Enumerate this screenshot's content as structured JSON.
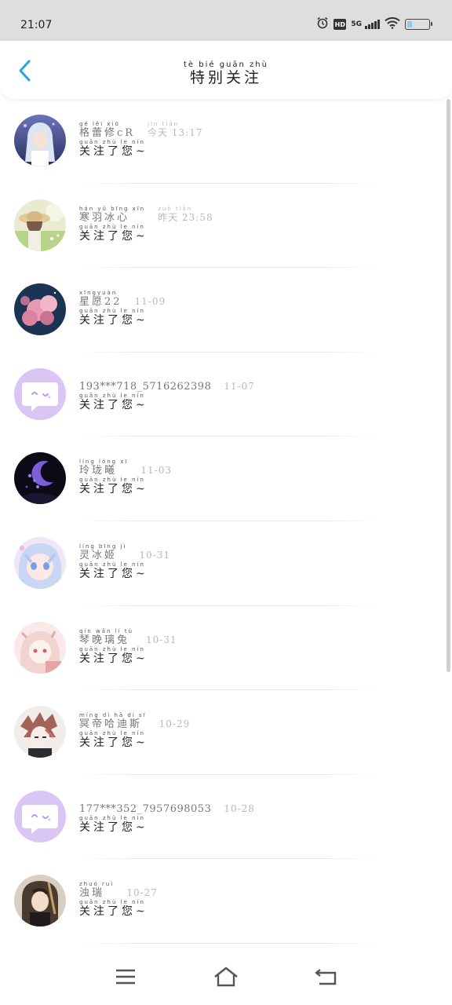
{
  "status_bar": {
    "time": "21:07",
    "hd_label": "HD",
    "network_label": "5G",
    "battery_level": 0.22,
    "icons": [
      "alarm-icon",
      "hd-icon",
      "signal-icon",
      "wifi-icon",
      "battery-icon"
    ]
  },
  "header": {
    "title_pinyin": "tè bié guān zhù",
    "title": "特别关注",
    "back_icon": "chevron-left-icon",
    "accent_color": "#2aa3e0"
  },
  "list": [
    {
      "name_pinyin": "gé lěi xiū",
      "name": "格蕾修cR",
      "date_pinyin": "jīn tiān",
      "date": "今天 13:17",
      "msg_pinyin": "guān zhù le nín",
      "message": "关注了您~",
      "avatar": "anime-girl-white-hair"
    },
    {
      "name_pinyin": "hán yǔ bīng xīn",
      "name": "寒羽冰心",
      "date_pinyin": "zuó tiān",
      "date": "昨天 23:58",
      "msg_pinyin": "guān zhù le nín",
      "message": "关注了您~",
      "avatar": "girl-straw-hat-field"
    },
    {
      "name_pinyin": "xīngyuàn",
      "name": "星愿22",
      "date_pinyin": "",
      "date": "11-09",
      "msg_pinyin": "guān zhù le nín",
      "message": "关注了您~",
      "avatar": "pink-blossom-night"
    },
    {
      "name_pinyin": "",
      "name": "193***718_5716262398",
      "date_pinyin": "",
      "date": "11-07",
      "msg_pinyin": "guān zhù le nín",
      "message": "关注了您~",
      "avatar": "default-chat-bubble"
    },
    {
      "name_pinyin": "líng lóng xī",
      "name": "玲珑曦",
      "date_pinyin": "",
      "date": "11-03",
      "msg_pinyin": "guān zhù le nín",
      "message": "关注了您~",
      "avatar": "dark-moon"
    },
    {
      "name_pinyin": "líng bīng jì",
      "name": "灵冰姬",
      "date_pinyin": "",
      "date": "10-31",
      "msg_pinyin": "guān zhù le nín",
      "message": "关注了您~",
      "avatar": "anime-girl-pastel"
    },
    {
      "name_pinyin": "qín wǎn lí tù",
      "name": "琴晚璃兔",
      "date_pinyin": "",
      "date": "10-31",
      "msg_pinyin": "guān zhù le nín",
      "message": "关注了您~",
      "avatar": "anime-girl-pink"
    },
    {
      "name_pinyin": "míng dì hā dí sī",
      "name": "冥帝哈迪斯",
      "date_pinyin": "",
      "date": "10-29",
      "msg_pinyin": "guān zhù le nín",
      "message": "关注了您~",
      "avatar": "anime-boy-sketch"
    },
    {
      "name_pinyin": "",
      "name": "177***352_7957698053",
      "date_pinyin": "",
      "date": "10-28",
      "msg_pinyin": "guān zhù le nín",
      "message": "关注了您~",
      "avatar": "default-chat-bubble"
    },
    {
      "name_pinyin": "zhuó ruì",
      "name": "浊瑞",
      "date_pinyin": "",
      "date": "10-27",
      "msg_pinyin": "guān zhù le nín",
      "message": "关注了您~",
      "avatar": "anime-boy-dark"
    }
  ],
  "nav_bar": {
    "icons": [
      "menu-icon",
      "home-icon",
      "back-icon"
    ]
  }
}
